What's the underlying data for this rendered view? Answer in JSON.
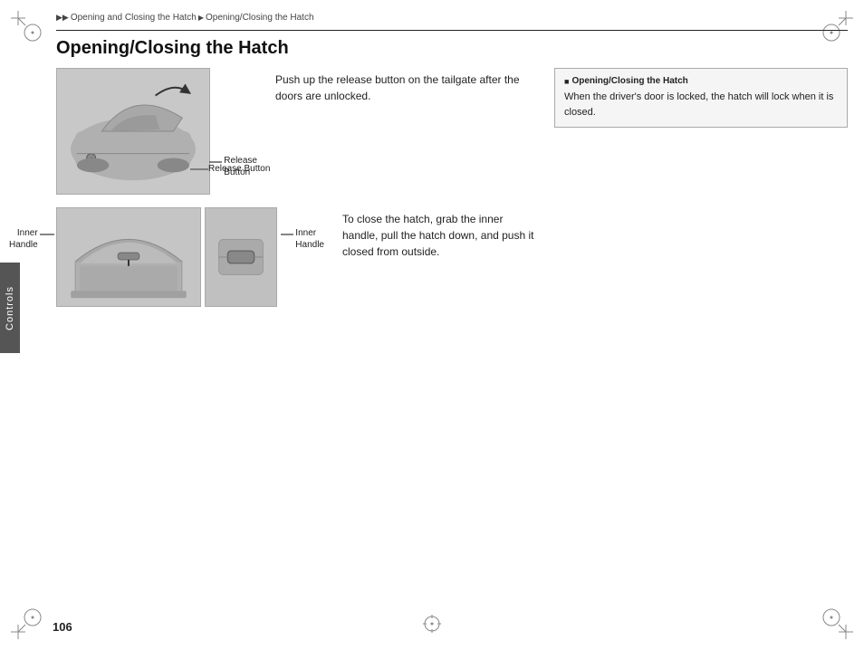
{
  "page": {
    "number": "106",
    "side_tab": "Controls"
  },
  "breadcrumb": {
    "parts": [
      "Opening and Closing the Hatch",
      "Opening/Closing the Hatch"
    ],
    "separator": "▶▶"
  },
  "title": "Opening/Closing the Hatch",
  "sections": [
    {
      "id": "top",
      "image_label": "Release\nButton",
      "description": "Push up the release button on the tailgate after the doors are unlocked."
    },
    {
      "id": "bottom",
      "image_label": "Inner\nHandle",
      "description": "To close the hatch, grab the inner handle, pull the hatch down, and push it closed from outside."
    }
  ],
  "note": {
    "title": "Opening/Closing the Hatch",
    "icon": "■",
    "text": "When the driver's door is locked, the hatch will lock when it is closed."
  }
}
